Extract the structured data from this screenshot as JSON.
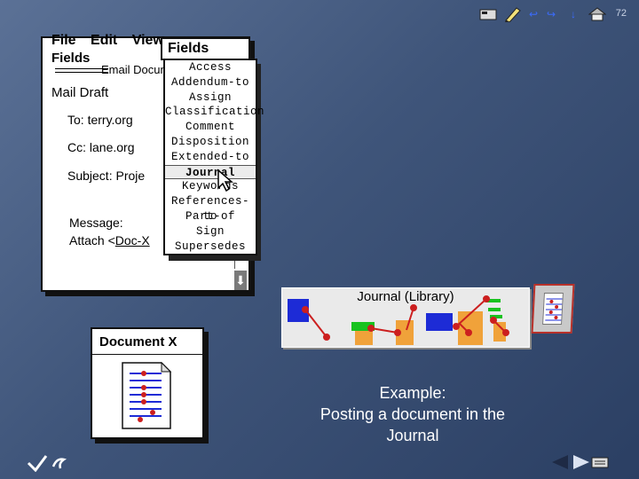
{
  "slide_number": "72",
  "nav": {
    "icons": [
      "menu-icon",
      "pen-icon",
      "back-icon",
      "forward-icon",
      "down-icon",
      "home-icon"
    ]
  },
  "window": {
    "menu": [
      "File",
      "Edit",
      "View"
    ],
    "fields_menu": "Fields",
    "title": "Email Docum",
    "draft_label": "Mail Draft",
    "to": "To: terry.org",
    "cc": "Cc: lane.org",
    "subject": "Subject: Proje",
    "message": "Message:",
    "attach_text": "Attach <",
    "attach_link": "Doc-X",
    "scroll_arrow": "⬇"
  },
  "fields_dropdown": {
    "title": "Fields",
    "items": [
      "Access",
      "Addendum-to",
      "Assign",
      "Classification",
      "Comment",
      "Disposition",
      "Extended-to",
      "Journal",
      "Keywords",
      "References-to",
      "Part-of",
      "Sign",
      "Supersedes"
    ],
    "selected": "Journal"
  },
  "journal": {
    "label": "Journal (Library)"
  },
  "document": {
    "title": "Document X"
  },
  "caption": {
    "line1": "Example:",
    "line2": "Posting a document in the",
    "line3": "Journal"
  },
  "colors": {
    "accent_red": "#cc1f1f",
    "blue_box": "#1d2bd6",
    "green_box": "#18c21f",
    "orange_box": "#f0a23a"
  }
}
